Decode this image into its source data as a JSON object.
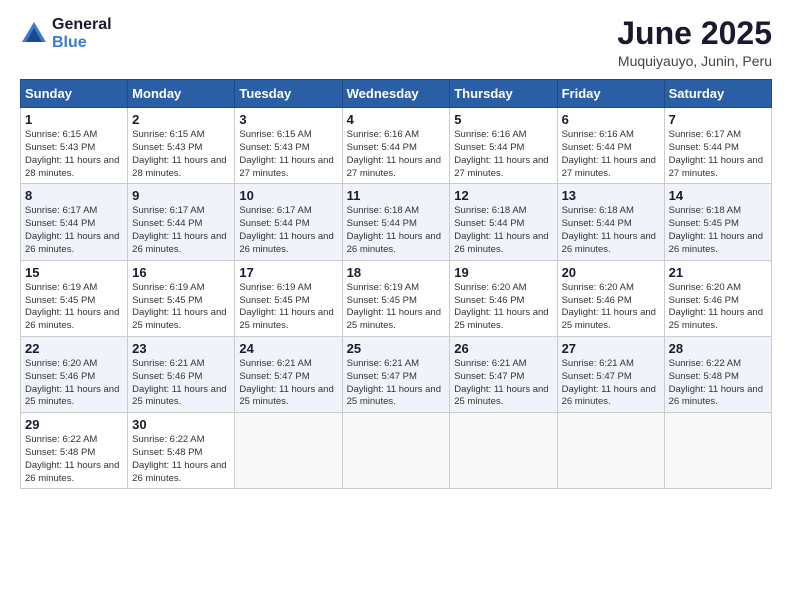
{
  "logo": {
    "line1": "General",
    "line2": "Blue"
  },
  "title": "June 2025",
  "subtitle": "Muquiyauyo, Junin, Peru",
  "header_days": [
    "Sunday",
    "Monday",
    "Tuesday",
    "Wednesday",
    "Thursday",
    "Friday",
    "Saturday"
  ],
  "weeks": [
    [
      {
        "day": "1",
        "sunrise": "Sunrise: 6:15 AM",
        "sunset": "Sunset: 5:43 PM",
        "daylight": "Daylight: 11 hours and 28 minutes."
      },
      {
        "day": "2",
        "sunrise": "Sunrise: 6:15 AM",
        "sunset": "Sunset: 5:43 PM",
        "daylight": "Daylight: 11 hours and 28 minutes."
      },
      {
        "day": "3",
        "sunrise": "Sunrise: 6:15 AM",
        "sunset": "Sunset: 5:43 PM",
        "daylight": "Daylight: 11 hours and 27 minutes."
      },
      {
        "day": "4",
        "sunrise": "Sunrise: 6:16 AM",
        "sunset": "Sunset: 5:44 PM",
        "daylight": "Daylight: 11 hours and 27 minutes."
      },
      {
        "day": "5",
        "sunrise": "Sunrise: 6:16 AM",
        "sunset": "Sunset: 5:44 PM",
        "daylight": "Daylight: 11 hours and 27 minutes."
      },
      {
        "day": "6",
        "sunrise": "Sunrise: 6:16 AM",
        "sunset": "Sunset: 5:44 PM",
        "daylight": "Daylight: 11 hours and 27 minutes."
      },
      {
        "day": "7",
        "sunrise": "Sunrise: 6:17 AM",
        "sunset": "Sunset: 5:44 PM",
        "daylight": "Daylight: 11 hours and 27 minutes."
      }
    ],
    [
      {
        "day": "8",
        "sunrise": "Sunrise: 6:17 AM",
        "sunset": "Sunset: 5:44 PM",
        "daylight": "Daylight: 11 hours and 26 minutes."
      },
      {
        "day": "9",
        "sunrise": "Sunrise: 6:17 AM",
        "sunset": "Sunset: 5:44 PM",
        "daylight": "Daylight: 11 hours and 26 minutes."
      },
      {
        "day": "10",
        "sunrise": "Sunrise: 6:17 AM",
        "sunset": "Sunset: 5:44 PM",
        "daylight": "Daylight: 11 hours and 26 minutes."
      },
      {
        "day": "11",
        "sunrise": "Sunrise: 6:18 AM",
        "sunset": "Sunset: 5:44 PM",
        "daylight": "Daylight: 11 hours and 26 minutes."
      },
      {
        "day": "12",
        "sunrise": "Sunrise: 6:18 AM",
        "sunset": "Sunset: 5:44 PM",
        "daylight": "Daylight: 11 hours and 26 minutes."
      },
      {
        "day": "13",
        "sunrise": "Sunrise: 6:18 AM",
        "sunset": "Sunset: 5:44 PM",
        "daylight": "Daylight: 11 hours and 26 minutes."
      },
      {
        "day": "14",
        "sunrise": "Sunrise: 6:18 AM",
        "sunset": "Sunset: 5:45 PM",
        "daylight": "Daylight: 11 hours and 26 minutes."
      }
    ],
    [
      {
        "day": "15",
        "sunrise": "Sunrise: 6:19 AM",
        "sunset": "Sunset: 5:45 PM",
        "daylight": "Daylight: 11 hours and 26 minutes."
      },
      {
        "day": "16",
        "sunrise": "Sunrise: 6:19 AM",
        "sunset": "Sunset: 5:45 PM",
        "daylight": "Daylight: 11 hours and 25 minutes."
      },
      {
        "day": "17",
        "sunrise": "Sunrise: 6:19 AM",
        "sunset": "Sunset: 5:45 PM",
        "daylight": "Daylight: 11 hours and 25 minutes."
      },
      {
        "day": "18",
        "sunrise": "Sunrise: 6:19 AM",
        "sunset": "Sunset: 5:45 PM",
        "daylight": "Daylight: 11 hours and 25 minutes."
      },
      {
        "day": "19",
        "sunrise": "Sunrise: 6:20 AM",
        "sunset": "Sunset: 5:46 PM",
        "daylight": "Daylight: 11 hours and 25 minutes."
      },
      {
        "day": "20",
        "sunrise": "Sunrise: 6:20 AM",
        "sunset": "Sunset: 5:46 PM",
        "daylight": "Daylight: 11 hours and 25 minutes."
      },
      {
        "day": "21",
        "sunrise": "Sunrise: 6:20 AM",
        "sunset": "Sunset: 5:46 PM",
        "daylight": "Daylight: 11 hours and 25 minutes."
      }
    ],
    [
      {
        "day": "22",
        "sunrise": "Sunrise: 6:20 AM",
        "sunset": "Sunset: 5:46 PM",
        "daylight": "Daylight: 11 hours and 25 minutes."
      },
      {
        "day": "23",
        "sunrise": "Sunrise: 6:21 AM",
        "sunset": "Sunset: 5:46 PM",
        "daylight": "Daylight: 11 hours and 25 minutes."
      },
      {
        "day": "24",
        "sunrise": "Sunrise: 6:21 AM",
        "sunset": "Sunset: 5:47 PM",
        "daylight": "Daylight: 11 hours and 25 minutes."
      },
      {
        "day": "25",
        "sunrise": "Sunrise: 6:21 AM",
        "sunset": "Sunset: 5:47 PM",
        "daylight": "Daylight: 11 hours and 25 minutes."
      },
      {
        "day": "26",
        "sunrise": "Sunrise: 6:21 AM",
        "sunset": "Sunset: 5:47 PM",
        "daylight": "Daylight: 11 hours and 25 minutes."
      },
      {
        "day": "27",
        "sunrise": "Sunrise: 6:21 AM",
        "sunset": "Sunset: 5:47 PM",
        "daylight": "Daylight: 11 hours and 26 minutes."
      },
      {
        "day": "28",
        "sunrise": "Sunrise: 6:22 AM",
        "sunset": "Sunset: 5:48 PM",
        "daylight": "Daylight: 11 hours and 26 minutes."
      }
    ],
    [
      {
        "day": "29",
        "sunrise": "Sunrise: 6:22 AM",
        "sunset": "Sunset: 5:48 PM",
        "daylight": "Daylight: 11 hours and 26 minutes."
      },
      {
        "day": "30",
        "sunrise": "Sunrise: 6:22 AM",
        "sunset": "Sunset: 5:48 PM",
        "daylight": "Daylight: 11 hours and 26 minutes."
      },
      null,
      null,
      null,
      null,
      null
    ]
  ]
}
